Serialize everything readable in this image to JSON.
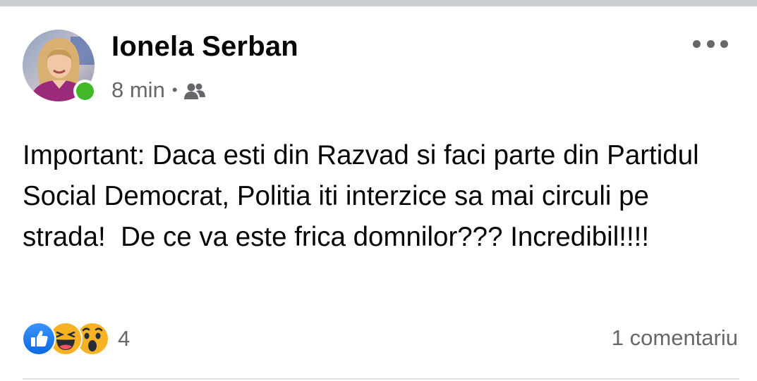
{
  "post": {
    "author_name": "Ionela Serban",
    "time_ago": "8 min",
    "separator": "•",
    "audience_icon": "friends-icon",
    "text": "Important: Daca esti din Razvad si faci parte din Partidul Social Democrat, Politia iti interzice sa mai circuli pe strada!  De ce va este frica domnilor??? Incredibil!!!!",
    "reactions": {
      "icons": [
        "like-icon",
        "haha-icon",
        "wow-icon"
      ],
      "count": "4"
    },
    "comments_label": "1 comentariu",
    "online": true
  },
  "colors": {
    "online_green": "#42b72a",
    "like_blue": "#1877f2",
    "emoji_yellow": "#f7b125",
    "secondary_text": "#65676b",
    "primary_text": "#050505"
  }
}
